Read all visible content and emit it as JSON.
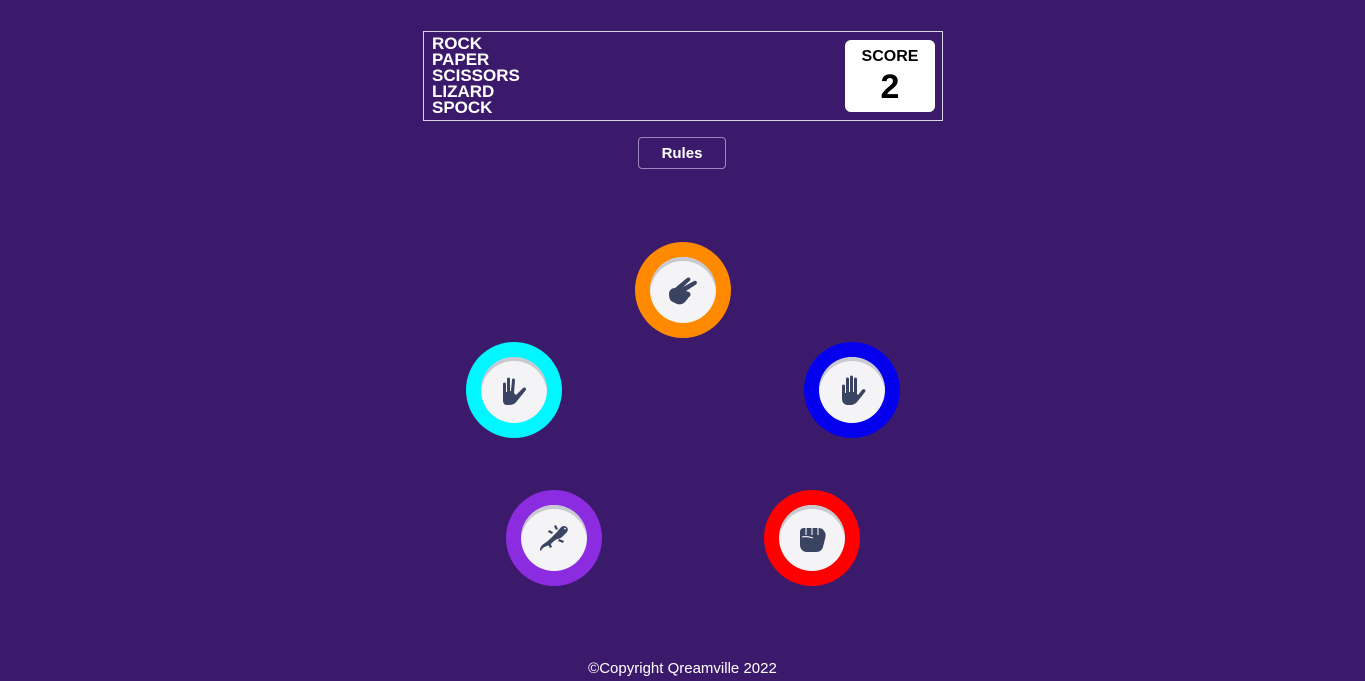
{
  "header": {
    "title_words": [
      "ROCK",
      "PAPER",
      "SCISSORS",
      "LIZARD",
      "SPOCK"
    ],
    "score_label": "SCORE",
    "score_value": "2"
  },
  "rules_button_label": "Rules",
  "choices": [
    {
      "id": "scissors",
      "icon": "scissors-hand-icon",
      "color": "#ff8a00"
    },
    {
      "id": "spock",
      "icon": "spock-hand-icon",
      "color": "#00f7ff"
    },
    {
      "id": "paper",
      "icon": "paper-hand-icon",
      "color": "#0400ee"
    },
    {
      "id": "lizard",
      "icon": "lizard-icon",
      "color": "#8b2ce0"
    },
    {
      "id": "rock",
      "icon": "rock-fist-icon",
      "color": "#ff0000"
    }
  ],
  "colors": {
    "background": "#3b1a6b",
    "icon": "#3b4363"
  },
  "footer": {
    "copyright": "©Copyright Qreamville 2022"
  }
}
